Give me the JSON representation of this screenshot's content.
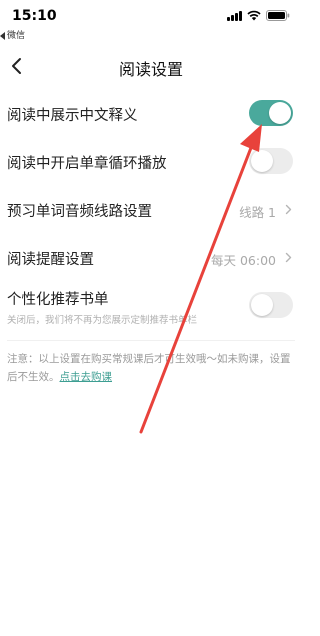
{
  "status_bar": {
    "time": "15:10",
    "back_app": "微信",
    "icons": [
      "signal-icon",
      "wifi-icon",
      "battery-icon"
    ]
  },
  "nav": {
    "title": "阅读设置",
    "back_icon": "chevron-left-icon"
  },
  "settings": [
    {
      "label": "阅读中展示中文释义",
      "type": "toggle",
      "on": true
    },
    {
      "label": "阅读中开启单章循环播放",
      "type": "toggle",
      "on": false
    },
    {
      "label": "预习单词音频线路设置",
      "type": "link",
      "value": "线路 1"
    },
    {
      "label": "阅读提醒设置",
      "type": "link",
      "value": "每天 06:00"
    },
    {
      "label": "个性化推荐书单",
      "sub": "关闭后，我们将不再为您展示定制推荐书单栏",
      "type": "toggle",
      "on": false
    }
  ],
  "notice": {
    "text": "注意：以上设置在购买常规课后才可生效哦～如未购课，设置后不生效。",
    "link": "点击去购课"
  },
  "colors": {
    "accent": "#4aa99c",
    "annotation_arrow": "#e8423b"
  }
}
